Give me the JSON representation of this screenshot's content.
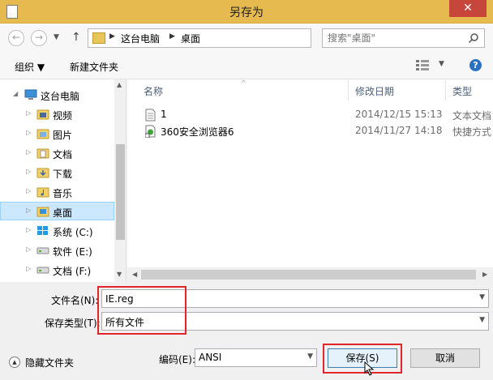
{
  "window": {
    "title": "另存为",
    "close_glyph": "✕"
  },
  "nav": {
    "back_icon": "arrow-left-icon",
    "forward_icon": "arrow-right-icon",
    "dropdown_icon": "chevron-down-icon",
    "up_icon": "arrow-up-icon",
    "address_segments": [
      "这台电脑",
      "桌面"
    ],
    "refresh_icon": "refresh-icon",
    "search_placeholder": "搜索\"桌面\""
  },
  "toolbar": {
    "organize_label": "组织 ▼",
    "new_folder_label": "新建文件夹",
    "help_glyph": "?"
  },
  "tree": [
    {
      "label": "这台电脑",
      "icon": "computer-icon",
      "expanded": true
    },
    {
      "label": "视频",
      "icon": "video-folder-icon"
    },
    {
      "label": "图片",
      "icon": "picture-folder-icon"
    },
    {
      "label": "文档",
      "icon": "document-folder-icon"
    },
    {
      "label": "下载",
      "icon": "download-folder-icon"
    },
    {
      "label": "音乐",
      "icon": "music-folder-icon"
    },
    {
      "label": "桌面",
      "icon": "desktop-folder-icon",
      "selected": true
    },
    {
      "label": "系统 (C:)",
      "icon": "windows-drive-icon"
    },
    {
      "label": "软件 (E:)",
      "icon": "drive-icon"
    },
    {
      "label": "文档 (F:)",
      "icon": "drive-icon"
    }
  ],
  "columns": {
    "name": "名称",
    "date": "修改日期",
    "type": "类型"
  },
  "files": [
    {
      "name": "1",
      "date": "2014/12/15 15:13",
      "type": "文本文档",
      "icon": "text-file-icon"
    },
    {
      "name": "360安全浏览器6",
      "date": "2014/11/27 14:18",
      "type": "快捷方式",
      "icon": "shortcut-icon"
    }
  ],
  "form": {
    "filename_label": "文件名(N):",
    "filename_value": "IE.reg",
    "filetype_label": "保存类型(T):",
    "filetype_value": "所有文件",
    "encoding_label": "编码(E):",
    "encoding_value": "ANSI",
    "hide_folders_label": "隐藏文件夹",
    "save_label": "保存(S)",
    "cancel_label": "取消"
  },
  "colors": {
    "titlebar": "#e7ba4f",
    "close_button": "#c7463b",
    "selection": "#cce8ff",
    "highlight_box": "#e0262a"
  }
}
